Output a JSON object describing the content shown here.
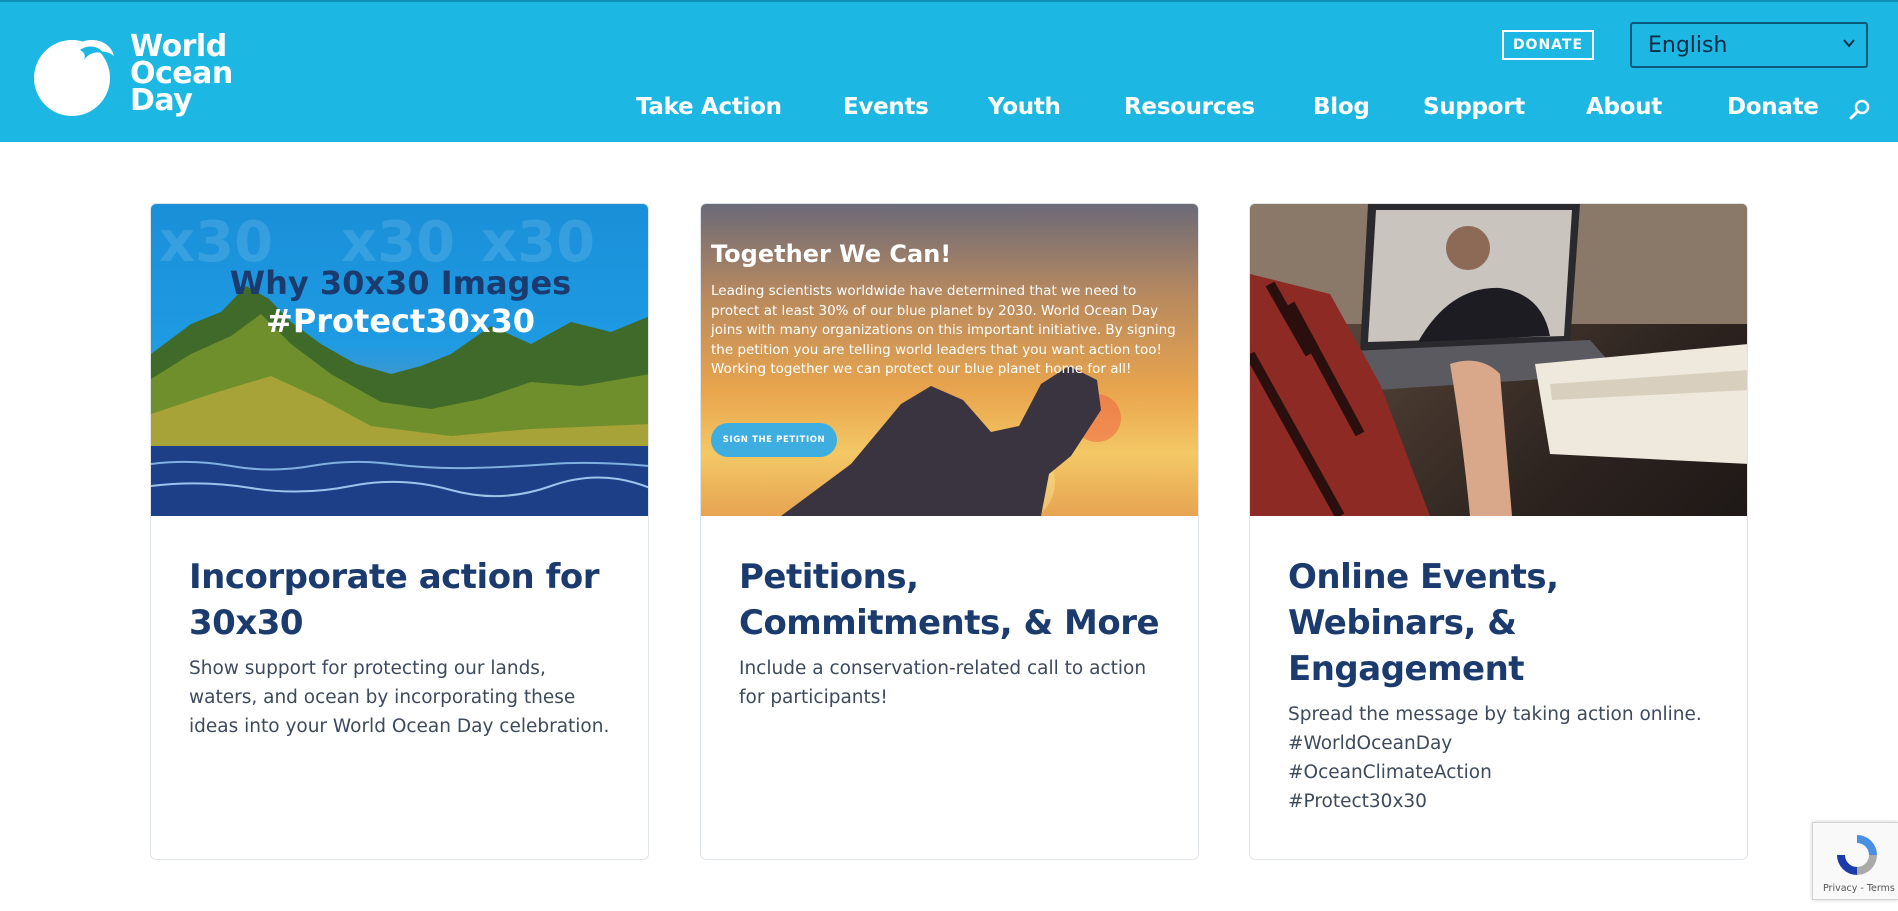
{
  "header": {
    "logo_lines": [
      "World",
      "Ocean",
      "Day"
    ],
    "donate_button": "DONATE",
    "language": "English",
    "nav": [
      "Take Action",
      "Events",
      "Youth",
      "Resources",
      "Blog",
      "Support",
      "About",
      "Donate"
    ],
    "search_icon": "search-icon",
    "color": "#1cb8e3"
  },
  "cards": [
    {
      "image": {
        "line1": "Why 30x30 Images",
        "line2": "#Protect30x30",
        "watermark": "x30"
      },
      "title_lines": [
        "Incorporate action for",
        "30x30"
      ],
      "text_lines": [
        "Show support for protecting our lands,",
        "waters, and ocean by incorporating these",
        "ideas into your World Ocean Day celebration."
      ]
    },
    {
      "image": {
        "title": "Together We Can!",
        "text": "Leading scientists worldwide have determined that we need to protect at least 30% of our blue planet by 2030. World Ocean Day joins with many organizations on this important initiative. By signing the petition you are telling world leaders that you want action too! Working together we can protect our blue planet home for all!",
        "button": "SIGN THE PETITION"
      },
      "title_lines": [
        "Petitions,",
        "Commitments, & More"
      ],
      "text_lines": [
        "Include a conservation-related call to action",
        "for participants!"
      ]
    },
    {
      "image": {},
      "title_lines": [
        "Online Events,",
        "Webinars, &",
        "Engagement"
      ],
      "text_lines": [
        "Spread the message by taking action online.",
        "#WorldOceanDay",
        "#OceanClimateAction",
        "#Protect30x30"
      ]
    }
  ],
  "recaptcha": {
    "text": "Privacy - Terms"
  }
}
